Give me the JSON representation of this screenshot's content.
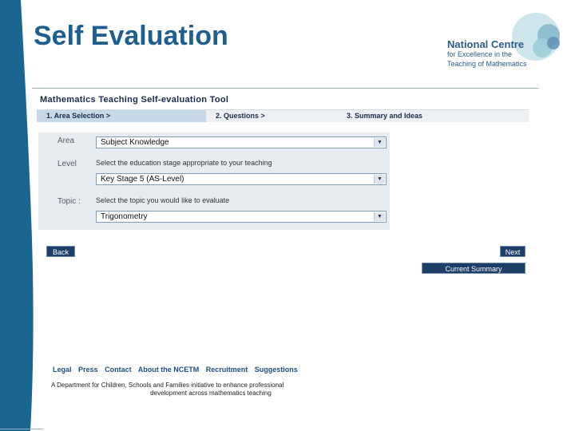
{
  "slide": {
    "title": "Self Evaluation"
  },
  "logo": {
    "name": "National Centre",
    "line2": "for Excellence in the",
    "line3": "Teaching of Mathematics"
  },
  "tool": {
    "title": "Mathematics Teaching Self-evaluation Tool",
    "tabs": [
      {
        "label": "1. Area Selection  >",
        "active": true
      },
      {
        "label": "2. Questions  >",
        "active": false
      },
      {
        "label": "3. Summary and Ideas",
        "active": false
      }
    ]
  },
  "form": {
    "area_label": "Area",
    "area_value": "Subject Knowledge",
    "level_label": "Level",
    "level_hint": "Select the education stage appropriate to your teaching",
    "level_value": "Key Stage 5 (AS-Level)",
    "topic_label": "Topic :",
    "topic_hint": "Select the topic you would like to evaluate",
    "topic_value": "Trigonometry"
  },
  "buttons": {
    "back": "Back",
    "next": "Next",
    "current_summary": "Current Summary"
  },
  "footer": {
    "links": [
      "Legal",
      "Press",
      "Contact",
      "About the NCETM",
      "Recruitment",
      "Suggestions"
    ],
    "line1": "A Department for Children, Schools and Families initiative to enhance professional",
    "line2": "development across mathematics teaching"
  },
  "colors": {
    "band": "#1b6690",
    "title": "#1f5f8f",
    "button": "#1d3e66",
    "active_tab": "#c7d9e8",
    "panel": "#e7ecf1"
  }
}
